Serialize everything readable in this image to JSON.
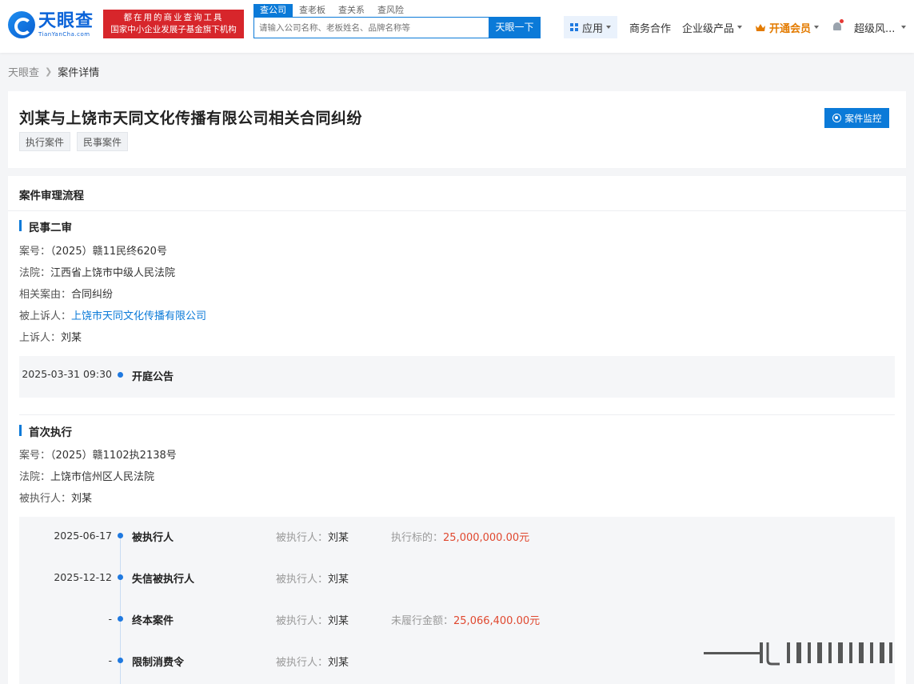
{
  "header": {
    "logo_cn": "天眼查",
    "logo_en": "TianYanCha.com",
    "slogan_line1": "都在用的商业查询工具",
    "slogan_line2": "国家中小企业发展子基金旗下机构",
    "search_tabs": [
      "查公司",
      "查老板",
      "查关系",
      "查风险"
    ],
    "search_placeholder": "请输入公司名称、老板姓名、品牌名称等",
    "search_button": "天眼一下",
    "nav_app": "应用",
    "nav_business": "商务合作",
    "nav_enterprise": "企业级产品",
    "nav_vip": "开通会员",
    "nav_user": "超级风..."
  },
  "breadcrumb": {
    "home": "天眼查",
    "current": "案件详情"
  },
  "case": {
    "title": "刘某与上饶市天同文化传播有限公司相关合同纠纷",
    "tags": [
      "执行案件",
      "民事案件"
    ],
    "monitor_button": "案件监控"
  },
  "process": {
    "title": "案件审理流程",
    "second_trial": {
      "title": "民事二审",
      "case_no_label": "案号：",
      "case_no": "（2025）赣11民终620号",
      "court_label": "法院：",
      "court": "江西省上饶市中级人民法院",
      "cause_label": "相关案由：",
      "cause": "合同纠纷",
      "appellee_label": "被上诉人：",
      "appellee": "上饶市天同文化传播有限公司",
      "appellant_label": "上诉人：",
      "appellant": "刘某",
      "events": [
        {
          "date": "2025-03-31 09:30",
          "name": "开庭公告"
        }
      ]
    },
    "first_execution": {
      "title": "首次执行",
      "case_no_label": "案号：",
      "case_no": "（2025）赣1102执2138号",
      "court_label": "法院：",
      "court": "上饶市信州区人民法院",
      "executed_label": "被执行人：",
      "executed": "刘某",
      "events": [
        {
          "date": "2025-06-17",
          "name": "被执行人",
          "party_label": "被执行人：",
          "party": "刘某",
          "amount_label": "执行标的：",
          "amount": "25,000,000.00元"
        },
        {
          "date": "2025-12-12",
          "name": "失信被执行人",
          "party_label": "被执行人：",
          "party": "刘某",
          "amount_label": "",
          "amount": ""
        },
        {
          "date": "-",
          "name": "终本案件",
          "party_label": "被执行人：",
          "party": "刘某",
          "amount_label": "未履行金额：",
          "amount": "25,066,400.00元"
        },
        {
          "date": "-",
          "name": "限制消费令",
          "party_label": "被执行人：",
          "party": "刘某",
          "amount_label": "",
          "amount": ""
        }
      ]
    }
  },
  "colors": {
    "accent": "#0b7ad8",
    "slogan_red": "#d7262b",
    "amount_red": "#e0482f",
    "vip_orange": "#e37b00"
  }
}
